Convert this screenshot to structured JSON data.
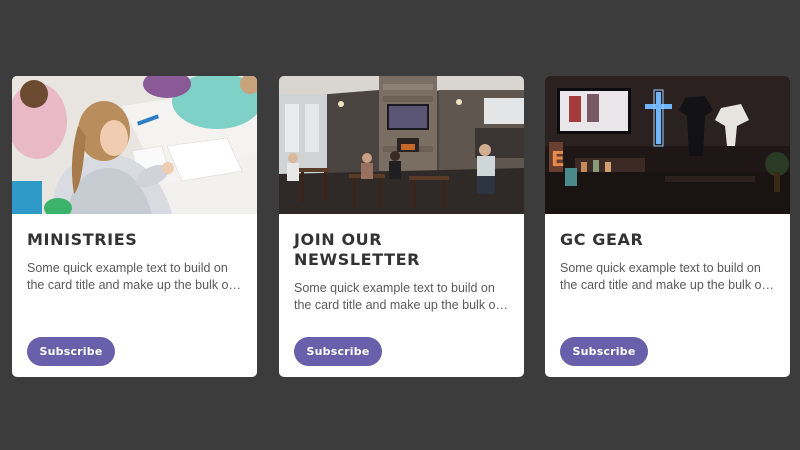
{
  "cards": [
    {
      "title": "Ministries",
      "text": "Some quick example text to build on the card title and make up the bulk of the card's content.",
      "button_label": "Subscribe"
    },
    {
      "title": "Join Our Newsletter",
      "text": "Some quick example text to build on the card title and make up the bulk of the card's content.",
      "button_label": "Subscribe"
    },
    {
      "title": "GC Gear",
      "text": "Some quick example text to build on the card title and make up the bulk of the card's content.",
      "button_label": "Subscribe"
    }
  ],
  "colors": {
    "page_background": "#3c3c3c",
    "card_background": "#ffffff",
    "button": "#6a5faa",
    "title": "#333333",
    "body_text": "#5a5a5a"
  }
}
